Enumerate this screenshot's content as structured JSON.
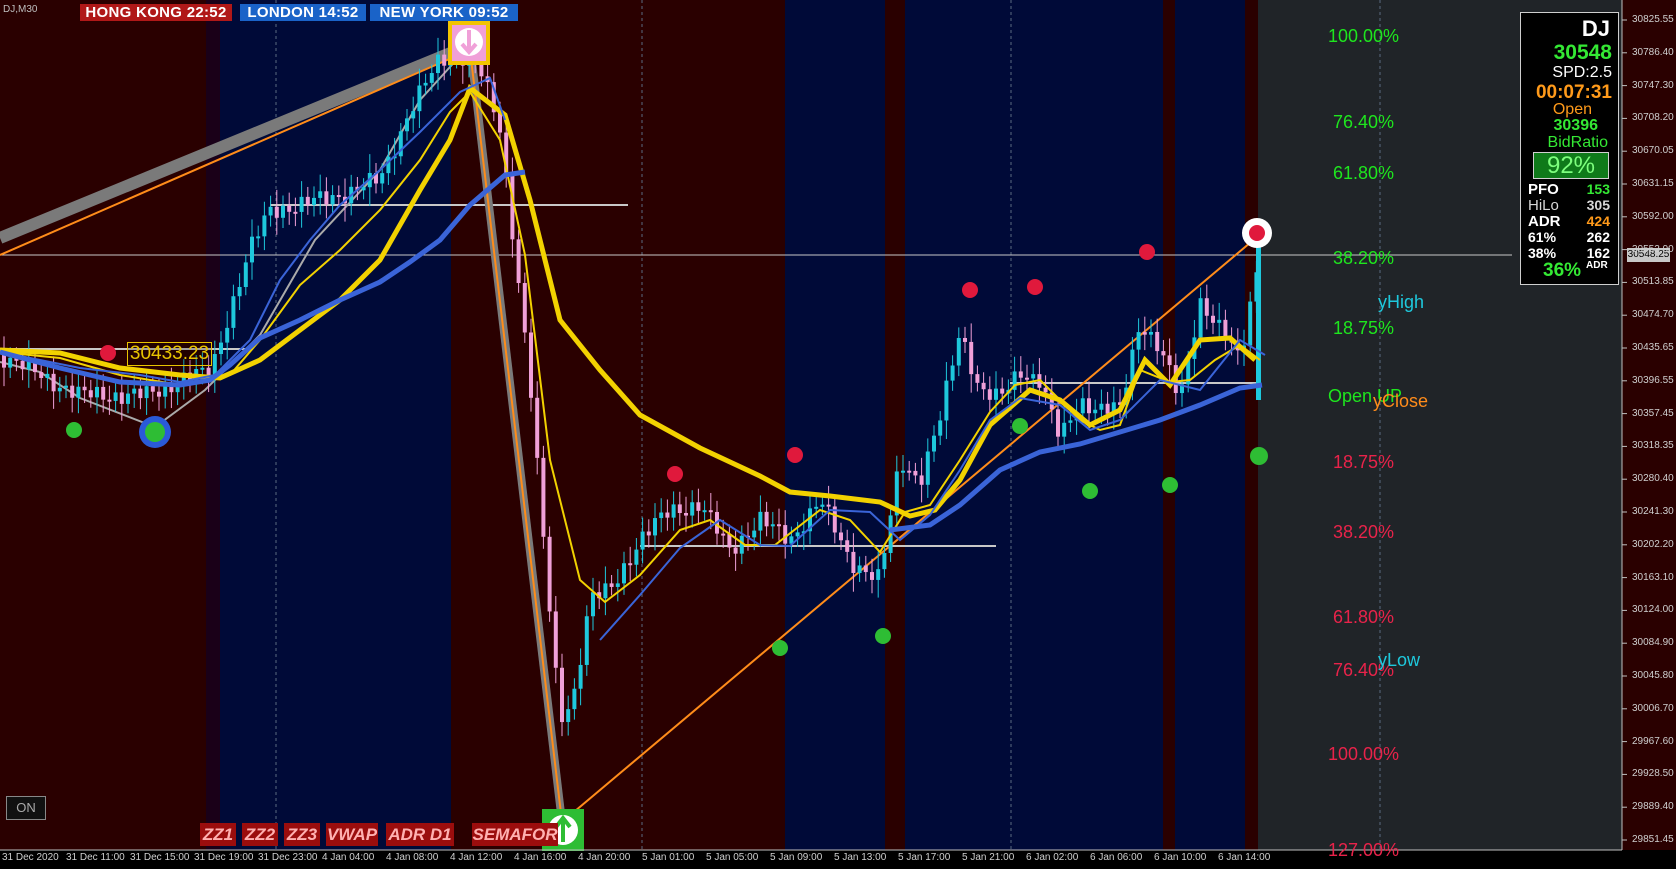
{
  "symbol": "DJ,M30",
  "clocks": [
    {
      "label": "HONG KONG  22:52",
      "color": "#b01818"
    },
    {
      "label": "LONDON  14:52",
      "color": "#1a63c8"
    },
    {
      "label": "NEW YORK  09:52",
      "color": "#1a63c8"
    }
  ],
  "price_tag": "30433.23",
  "current_price": "30548.25",
  "info_panel": {
    "symbol": "DJ",
    "price": "30548",
    "spread": "SPD:2.5",
    "timer": "00:07:31",
    "open_label": "Open",
    "open_value": "30396",
    "bid_label": "BidRatio",
    "bid_value": "92%",
    "rows": [
      {
        "label": "PFO",
        "value": "153",
        "value_color": "#34e834"
      },
      {
        "label": "HiLo",
        "value": "305",
        "value_color": "#d8d8d8"
      },
      {
        "label": "ADR",
        "value": "424",
        "value_color": "#ff9a1a"
      },
      {
        "label": "61%",
        "value": "262",
        "value_color": "#ffffff"
      },
      {
        "label": "38%",
        "value": "162",
        "value_color": "#ffffff"
      }
    ],
    "adr_pct": "36%",
    "adr_small": "ADR"
  },
  "fib_up": [
    "100.00%",
    "76.40%",
    "61.80%",
    "38.20%",
    "18.75%"
  ],
  "fib_down": [
    "18.75%",
    "38.20%",
    "61.80%",
    "76.40%",
    "100.00%",
    "127.00%"
  ],
  "labels": {
    "yhigh": "yHigh",
    "openup": "Open UP",
    "yclose": "yClose",
    "ylow": "yLow"
  },
  "toolbar": {
    "on_label": "ON",
    "buttons": [
      "ZZ1",
      "ZZ2",
      "ZZ3",
      "VWAP",
      "ADR D1",
      "SEMAFOR"
    ]
  },
  "y_axis_ticks": [
    "30825.55",
    "30786.40",
    "30747.30",
    "30708.20",
    "30670.05",
    "30631.15",
    "30592.00",
    "30552.90",
    "30513.85",
    "30474.70",
    "30435.65",
    "30396.55",
    "30357.45",
    "30318.35",
    "30280.40",
    "30241.30",
    "30202.20",
    "30163.10",
    "30124.00",
    "30084.90",
    "30045.80",
    "30006.70",
    "29967.60",
    "29928.50",
    "29889.40",
    "29851.45"
  ],
  "x_axis_ticks": [
    "31 Dec 2020",
    "31 Dec 11:00",
    "31 Dec 15:00",
    "31 Dec 19:00",
    "31 Dec 23:00",
    "4 Jan 04:00",
    "4 Jan 08:00",
    "4 Jan 12:00",
    "4 Jan 16:00",
    "4 Jan 20:00",
    "5 Jan 01:00",
    "5 Jan 05:00",
    "5 Jan 09:00",
    "5 Jan 13:00",
    "5 Jan 17:00",
    "5 Jan 21:00",
    "6 Jan 02:00",
    "6 Jan 06:00",
    "6 Jan 10:00",
    "6 Jan 14:00"
  ],
  "colors": {
    "bull": "#1ec8dc",
    "bear": "#f0a0d8",
    "ma_fast": "#f2d200",
    "ma_slow": "#3a64d8",
    "zigzag": "#ff8c1a",
    "fib_up": "#1ee61e",
    "fib_down": "#e8234a"
  }
}
